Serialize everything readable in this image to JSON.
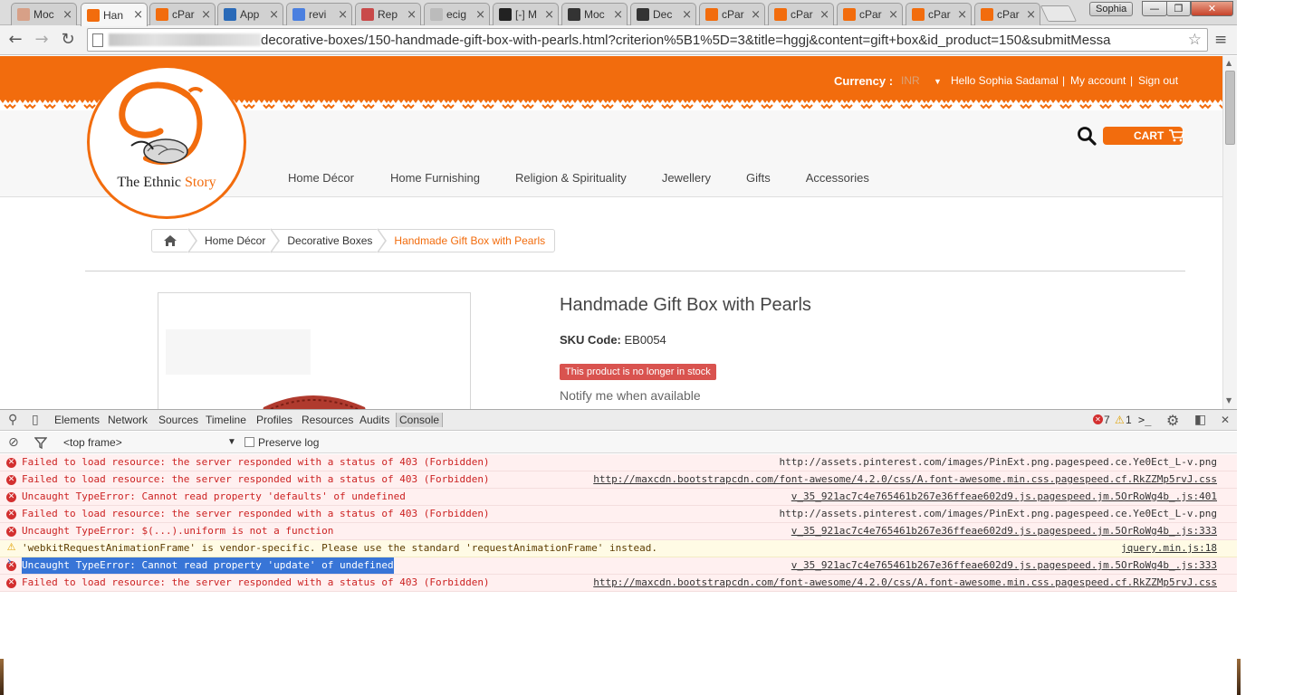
{
  "tabs": [
    {
      "label": "Moc",
      "icon": "dragon-icon",
      "color": "#d7a087",
      "active": false
    },
    {
      "label": "Han",
      "icon": "ethnic-story-icon",
      "color": "#f26c0d",
      "active": true
    },
    {
      "label": "cPar",
      "icon": "cpanel-icon",
      "color": "#f26c0d",
      "active": false
    },
    {
      "label": "App",
      "icon": "ox-icon",
      "color": "#2a6ab8",
      "active": false
    },
    {
      "label": "revi",
      "icon": "google-icon",
      "color": "#4a7fe0",
      "active": false
    },
    {
      "label": "Rep",
      "icon": "reddit-alien-icon",
      "color": "#c94a4a",
      "active": false
    },
    {
      "label": "ecig",
      "icon": "page-icon",
      "color": "#bbbbbb",
      "active": false
    },
    {
      "label": "[-] M",
      "icon": "github-icon",
      "color": "#222222",
      "active": false
    },
    {
      "label": "Moc",
      "icon": "suitcase-icon",
      "color": "#333333",
      "active": false
    },
    {
      "label": "Dec",
      "icon": "suitcase-icon",
      "color": "#333333",
      "active": false
    },
    {
      "label": "cPar",
      "icon": "cpanel-icon",
      "color": "#f26c0d",
      "active": false
    },
    {
      "label": "cPar",
      "icon": "cpanel-icon",
      "color": "#f26c0d",
      "active": false
    },
    {
      "label": "cPar",
      "icon": "cpanel-icon",
      "color": "#f26c0d",
      "active": false
    },
    {
      "label": "cPar",
      "icon": "cpanel-icon",
      "color": "#f26c0d",
      "active": false
    },
    {
      "label": "cPar",
      "icon": "cpanel-icon",
      "color": "#f26c0d",
      "active": false
    }
  ],
  "window": {
    "profile": "Sophia",
    "minimize": "—",
    "maximize": "❐",
    "close": "✕"
  },
  "toolbar": {
    "url": "decorative-boxes/150-handmade-gift-box-with-pearls.html?criterion%5B1%5D=3&title=hggj&content=gift+box&id_product=150&submitMessa"
  },
  "site": {
    "currency_label": "Currency :",
    "currency_value": "INR",
    "greeting": "Hello Sophia Sadamal",
    "sep": "|",
    "my_account": "My account",
    "sign_out": "Sign out",
    "logo_main": "The Ethnic",
    "logo_accent": "Story",
    "cart": "CART",
    "nav": [
      "Home Décor",
      "Home Furnishing",
      "Religion & Spirituality",
      "Jewellery",
      "Gifts",
      "Accessories"
    ],
    "breadcrumb": [
      "Home Décor",
      "Decorative Boxes",
      "Handmade Gift Box with Pearls"
    ],
    "accent_color": "#f26c0d"
  },
  "product": {
    "title": "Handmade Gift Box with Pearls",
    "sku_label": "SKU Code:",
    "sku": "EB0054",
    "stock_badge": "This product is no longer in stock",
    "notify": "Notify me when available",
    "badge_color": "#d9534f"
  },
  "devtools": {
    "tabs": [
      "Elements",
      "Network",
      "Sources",
      "Timeline",
      "Profiles",
      "Resources",
      "Audits",
      "Console"
    ],
    "selected_tab": "Console",
    "error_count": "7",
    "warning_count": "1",
    "frame": "<top frame>",
    "preserve_log": "Preserve log",
    "messages": [
      {
        "level": "error",
        "text": "Failed to load resource: the server responded with a status of 403 (Forbidden)",
        "source": "http://assets.pinterest.com/images/PinExt.png.pagespeed.ce.Ye0Ect_L-v.png",
        "underline": false,
        "highlight": false
      },
      {
        "level": "error",
        "text": "Failed to load resource: the server responded with a status of 403 (Forbidden)",
        "source": "http://maxcdn.bootstrapcdn.com/font-awesome/4.2.0/css/A.font-awesome.min.css.pagespeed.cf.RkZZMp5rvJ.css",
        "underline": true,
        "highlight": false
      },
      {
        "level": "error",
        "text": "Uncaught TypeError: Cannot read property 'defaults' of undefined",
        "source": "v_35_921ac7c4e765461b267e36ffeae602d9.js.pagespeed.jm.5OrRoWg4b_.js:401",
        "underline": true,
        "highlight": false
      },
      {
        "level": "error",
        "text": "Failed to load resource: the server responded with a status of 403 (Forbidden)",
        "source": "http://assets.pinterest.com/images/PinExt.png.pagespeed.ce.Ye0Ect_L-v.png",
        "underline": false,
        "highlight": false
      },
      {
        "level": "error",
        "text": "Uncaught TypeError: $(...).uniform is not a function",
        "source": "v_35_921ac7c4e765461b267e36ffeae602d9.js.pagespeed.jm.5OrRoWg4b_.js:333",
        "underline": true,
        "highlight": false
      },
      {
        "level": "warning",
        "text": "'webkitRequestAnimationFrame' is vendor-specific. Please use the standard 'requestAnimationFrame' instead.",
        "source": "jquery.min.js:18",
        "underline": true,
        "highlight": false
      },
      {
        "level": "error",
        "text": "Uncaught TypeError: Cannot read property 'update' of undefined",
        "source": "v_35_921ac7c4e765461b267e36ffeae602d9.js.pagespeed.jm.5OrRoWg4b_.js:333",
        "underline": true,
        "highlight": true
      },
      {
        "level": "error",
        "text": "Failed to load resource: the server responded with a status of 403 (Forbidden)",
        "source": "http://maxcdn.bootstrapcdn.com/font-awesome/4.2.0/css/A.font-awesome.min.css.pagespeed.cf.RkZZMp5rvJ.css",
        "underline": true,
        "highlight": false
      }
    ],
    "prompt": "›"
  }
}
